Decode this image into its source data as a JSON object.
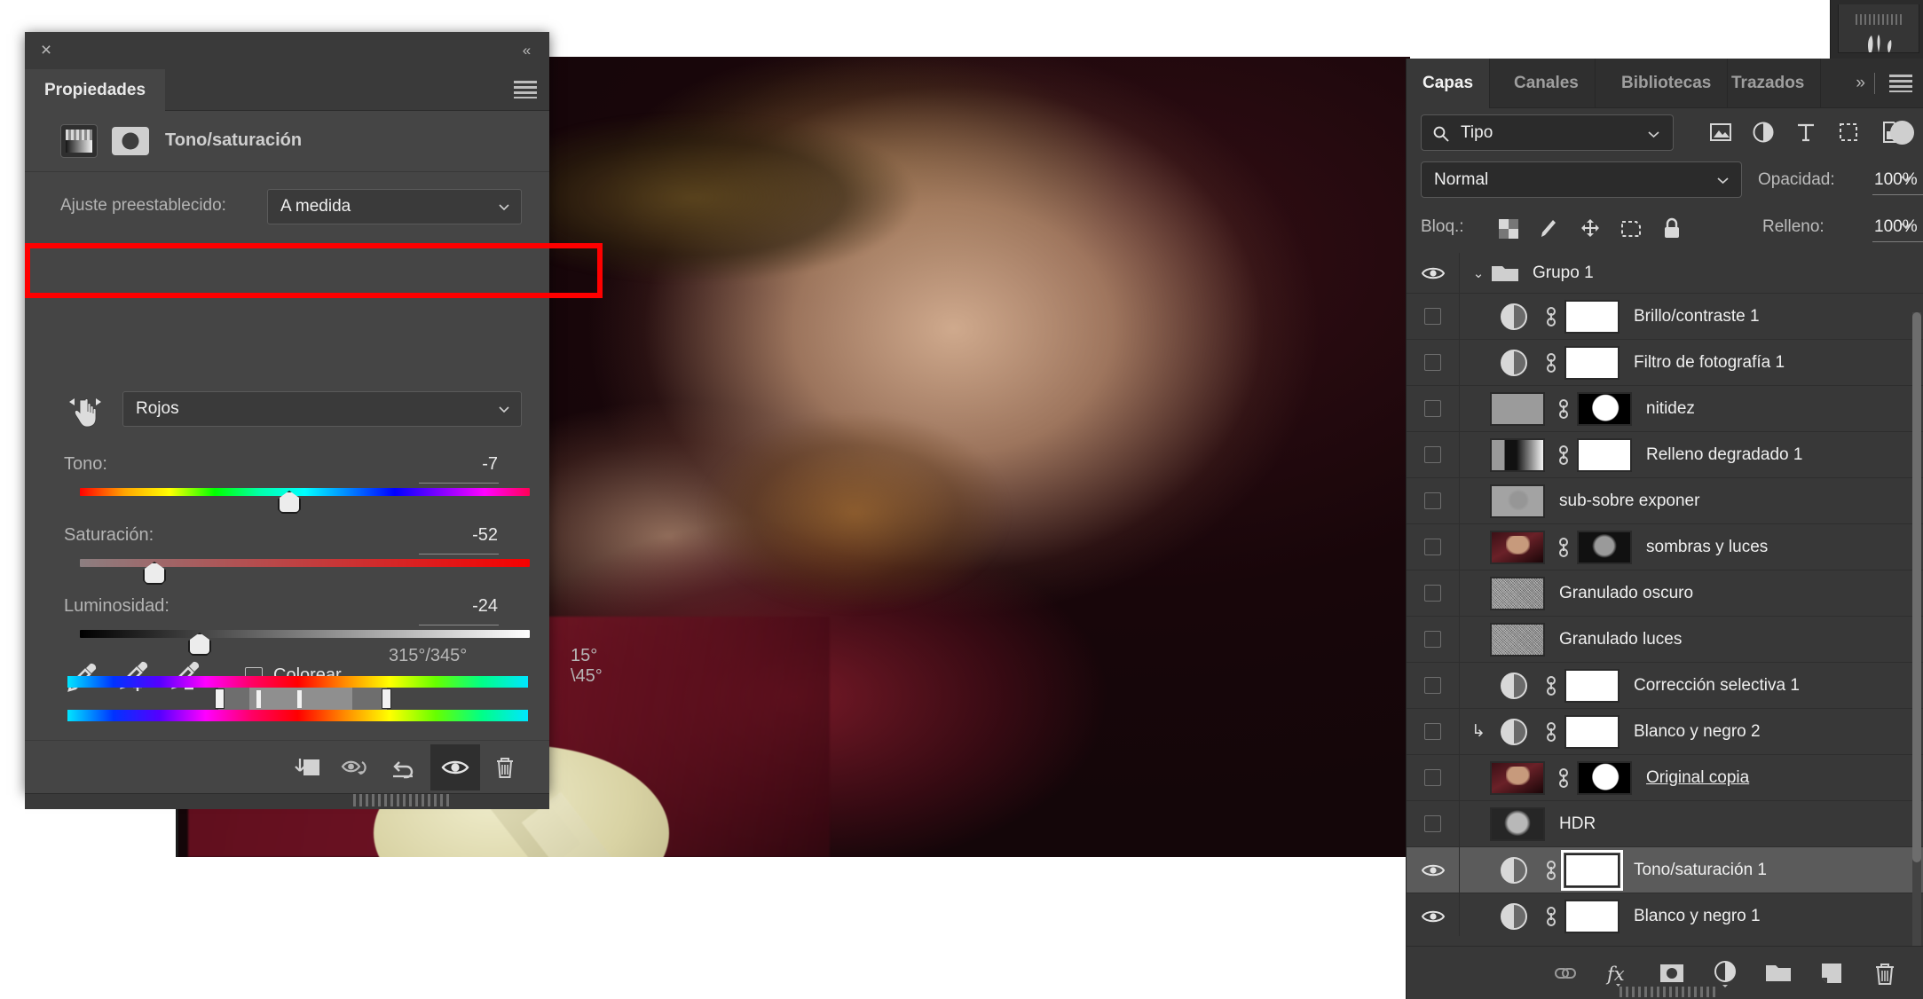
{
  "properties_panel": {
    "close_icon": "×",
    "collapse_icon": "«",
    "tab_label": "Propiedades",
    "menu_icon": "panel-menu-icon",
    "adjustment_title": "Tono/saturación",
    "preset": {
      "label": "Ajuste preestablecido:",
      "value": "A medida"
    },
    "range": {
      "value": "Rojos"
    },
    "sliders": [
      {
        "label": "Tono:",
        "value": "-7",
        "percent": 46.5,
        "track": "hue"
      },
      {
        "label": "Saturación:",
        "value": "-52",
        "percent": 16.5,
        "track": "saturation"
      },
      {
        "label": "Luminosidad:",
        "value": "-24",
        "percent": 26.5,
        "track": "lightness"
      }
    ],
    "eyedroppers": [
      "eyedropper-icon",
      "eyedropper-add-icon",
      "eyedropper-subtract-icon"
    ],
    "colorize": {
      "label": "Colorear",
      "checked": false
    },
    "hue_range": {
      "left_label": "315°/345°",
      "right_label": "15°\\45°"
    },
    "footer_buttons": [
      {
        "name": "clip-to-layer-button",
        "icon": "clip-to-layer-icon",
        "active": false
      },
      {
        "name": "toggle-previous-state-button",
        "icon": "eye-rotate-icon",
        "active": false
      },
      {
        "name": "reset-button",
        "icon": "undo-arrow-icon",
        "active": false
      },
      {
        "name": "toggle-visibility-button",
        "icon": "eye-icon",
        "active": true
      },
      {
        "name": "delete-layer-button",
        "icon": "trash-icon",
        "active": false
      }
    ]
  },
  "layers_panel": {
    "tabs": [
      {
        "label": "Capas",
        "active": true
      },
      {
        "label": "Canales",
        "active": false
      },
      {
        "label": "Bibliotecas",
        "active": false
      },
      {
        "label": "Trazados",
        "active": false
      }
    ],
    "more_tabs_icon": "»",
    "panel_menu_icon": "hamburger-icon",
    "filter": {
      "value": "Tipo",
      "search_icon": "magnifier-icon",
      "type_icons": [
        "pixel-layer-filter-icon",
        "adjustment-layer-filter-icon",
        "text-layer-filter-icon",
        "shape-layer-filter-icon",
        "smart-object-filter-icon"
      ],
      "toggle_icon": "filter-toggle-icon"
    },
    "blend": {
      "mode": "Normal",
      "opacity_label": "Opacidad:",
      "opacity_value": "100%"
    },
    "lock": {
      "label": "Bloq.:",
      "icons": [
        "lock-transparency-icon",
        "lock-image-pixels-icon",
        "lock-position-icon",
        "lock-artboard-icon",
        "lock-all-icon"
      ],
      "fill_label": "Relleno:",
      "fill_value": "100%"
    },
    "group": {
      "name": "Grupo 1",
      "visible": true,
      "expanded": true,
      "chevron": "⌄",
      "folder_icon": "folder-icon"
    },
    "layers": [
      {
        "name": "Brillo/contraste 1",
        "visible": false,
        "kind": "adjustment",
        "mask": "white",
        "linked": true,
        "clipped": false,
        "selected": false
      },
      {
        "name": "Filtro de fotografía 1",
        "visible": false,
        "kind": "adjustment",
        "mask": "white",
        "linked": true,
        "clipped": false,
        "selected": false
      },
      {
        "name": "nitidez",
        "visible": false,
        "kind": "grayflat",
        "mask": "maskface",
        "linked": true,
        "clipped": false,
        "selected": false
      },
      {
        "name": "Relleno degradado 1",
        "visible": false,
        "kind": "gradient",
        "mask": "white",
        "linked": true,
        "clipped": false,
        "selected": false
      },
      {
        "name": "sub-sobre exponer",
        "visible": false,
        "kind": "sobre",
        "mask": null,
        "linked": false,
        "clipped": false,
        "selected": false
      },
      {
        "name": "sombras y luces",
        "visible": false,
        "kind": "photo",
        "mask": "dark",
        "linked": true,
        "clipped": false,
        "selected": false
      },
      {
        "name": "Granulado oscuro",
        "visible": false,
        "kind": "noise",
        "mask": null,
        "linked": false,
        "clipped": false,
        "selected": false
      },
      {
        "name": "Granulado luces",
        "visible": false,
        "kind": "noise",
        "mask": null,
        "linked": false,
        "clipped": false,
        "selected": false
      },
      {
        "name": "Corrección selectiva 1",
        "visible": false,
        "kind": "adjustment",
        "mask": "white",
        "linked": true,
        "clipped": false,
        "selected": false
      },
      {
        "name": "Blanco y negro 2",
        "visible": false,
        "kind": "adjustment",
        "mask": "white",
        "linked": true,
        "clipped": true,
        "selected": false
      },
      {
        "name": "Original copia",
        "visible": false,
        "kind": "photo",
        "mask": "maskface",
        "linked": true,
        "clipped": false,
        "selected": false,
        "underline": true
      },
      {
        "name": "HDR",
        "visible": false,
        "kind": "hdr",
        "mask": null,
        "linked": false,
        "clipped": false,
        "selected": false
      },
      {
        "name": "Tono/saturación 1",
        "visible": true,
        "kind": "adjustment",
        "mask": "white",
        "linked": true,
        "clipped": false,
        "selected": true
      },
      {
        "name": "Blanco y negro 1",
        "visible": true,
        "kind": "adjustment",
        "mask": "white",
        "linked": true,
        "clipped": false,
        "selected": false
      }
    ],
    "footer_buttons": [
      {
        "name": "link-layers-button",
        "icon": "link-icon"
      },
      {
        "name": "layer-style-button",
        "icon": "fx-icon"
      },
      {
        "name": "add-layer-mask-button",
        "icon": "mask-icon"
      },
      {
        "name": "new-adjustment-button",
        "icon": "adjustment-icon"
      },
      {
        "name": "new-group-button",
        "icon": "folder-icon"
      },
      {
        "name": "new-layer-button",
        "icon": "new-layer-icon"
      },
      {
        "name": "delete-layer-button",
        "icon": "trash-icon"
      }
    ]
  },
  "annotation": {
    "highlight_color": "#FE0000",
    "target": "Rojos"
  }
}
